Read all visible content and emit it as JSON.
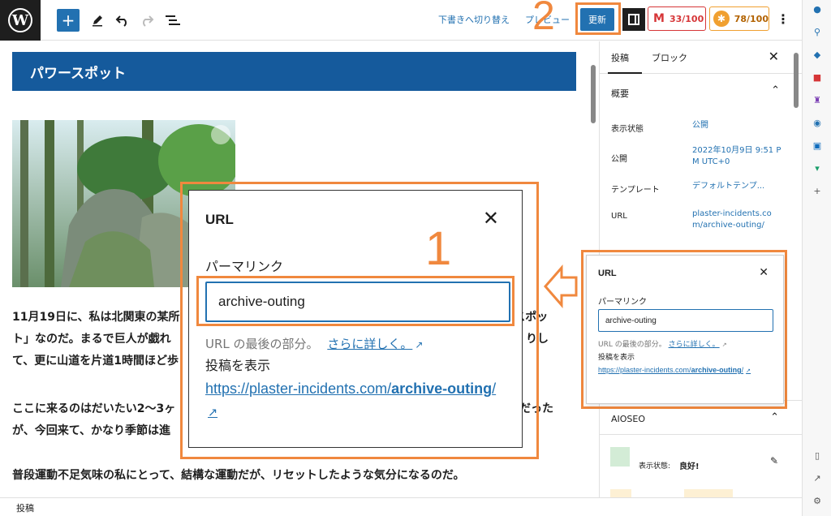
{
  "toolbar": {
    "wp_logo": "W",
    "draft_label": "下書きへ切り替え",
    "preview_label": "プレビュー",
    "update_label": "更新",
    "score_red": "33/100",
    "score_orange": "78/100",
    "score_red_icon": "M",
    "more_icon": "⋮"
  },
  "annotations": {
    "step1": "1",
    "step2": "2",
    "highlight_color": "#f0883e"
  },
  "post": {
    "heading": "パワースポット",
    "paragraphs": [
      "11月19日に、私は北関東の某所",
      "ト」なのだ。まるで巨人が戯れ",
      "て、更に山道を片道1時間ほど歩",
      "ここに来るのはだいたい2〜3ヶ",
      "が、今回来て、かなり季節は進",
      "普段運動不足気味の私にとって、結構な運動だが、リセットしたような気分になるのだ。"
    ],
    "para_right_fragments": [
      "ースポッ",
      "りし",
      "だった"
    ]
  },
  "statusbar": {
    "label": "投稿"
  },
  "sidebar": {
    "tabs": [
      "投稿",
      "ブロック"
    ],
    "summary_title": "概要",
    "rows": [
      {
        "label": "表示状態",
        "value": "公開"
      },
      {
        "label": "公開",
        "value": "2022年10月9日 9:51 PM UTC+0"
      },
      {
        "label": "テンプレート",
        "value": "デフォルトテンプ..."
      },
      {
        "label": "URL",
        "value": "plaster-incidents.com/archive-outing/"
      }
    ],
    "aioseo_title": "AIOSEO",
    "aioseo_status_label": "表示状態:",
    "aioseo_status_value": "良好!"
  },
  "url_popup": {
    "title": "URL",
    "permalink_label": "パーマリンク",
    "slug_value": "archive-outing",
    "help_text": "URL の最後の部分。",
    "help_link": "さらに詳しく。",
    "view_post_label": "投稿を表示",
    "url_prefix": "https://plaster-incidents.com/",
    "url_slug": "archive-outing",
    "url_suffix": "/"
  },
  "colors": {
    "accent": "#2271b1",
    "heading_bg": "#155a9c",
    "score_red": "#d63638",
    "score_orange": "#f0a030"
  }
}
